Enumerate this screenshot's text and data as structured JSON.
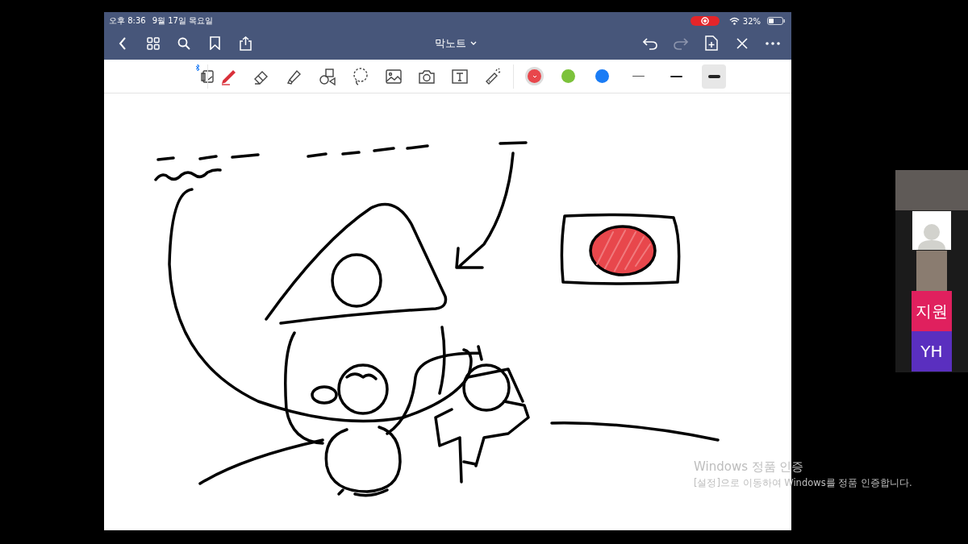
{
  "status_bar": {
    "time": "오후 8:36",
    "date": "9월 17일 목요일",
    "battery": "32%"
  },
  "nav_bar": {
    "title": "막노트"
  },
  "toolbar": {
    "tools": [
      {
        "kind": "pages",
        "selected": false
      },
      {
        "kind": "pen",
        "selected": true
      },
      {
        "kind": "eraser",
        "selected": false
      },
      {
        "kind": "highlighter",
        "selected": false
      },
      {
        "kind": "shapes",
        "selected": false
      },
      {
        "kind": "lasso",
        "selected": false
      },
      {
        "kind": "image",
        "selected": false
      },
      {
        "kind": "camera",
        "selected": false
      },
      {
        "kind": "text",
        "selected": false
      },
      {
        "kind": "laser",
        "selected": false
      }
    ],
    "colors": [
      {
        "color": "#e8474c",
        "selected": true
      },
      {
        "color": "#7cc23b",
        "selected": false
      },
      {
        "color": "#1a7cf5",
        "selected": false
      }
    ],
    "widths": [
      {
        "selected": false
      },
      {
        "selected": false
      },
      {
        "selected": true
      }
    ]
  },
  "participants": [
    {
      "kind": "video"
    },
    {
      "kind": "avatar"
    },
    {
      "kind": "video"
    },
    {
      "kind": "initials",
      "label": "지원",
      "color": "#e0205e"
    },
    {
      "kind": "initials",
      "label": "YH",
      "color": "#5a2fbf"
    }
  ],
  "activation_notice": {
    "title": "Windows 정품 인증",
    "message": "[설정]으로 이동하여 Windows를 정품 인증합니다."
  }
}
